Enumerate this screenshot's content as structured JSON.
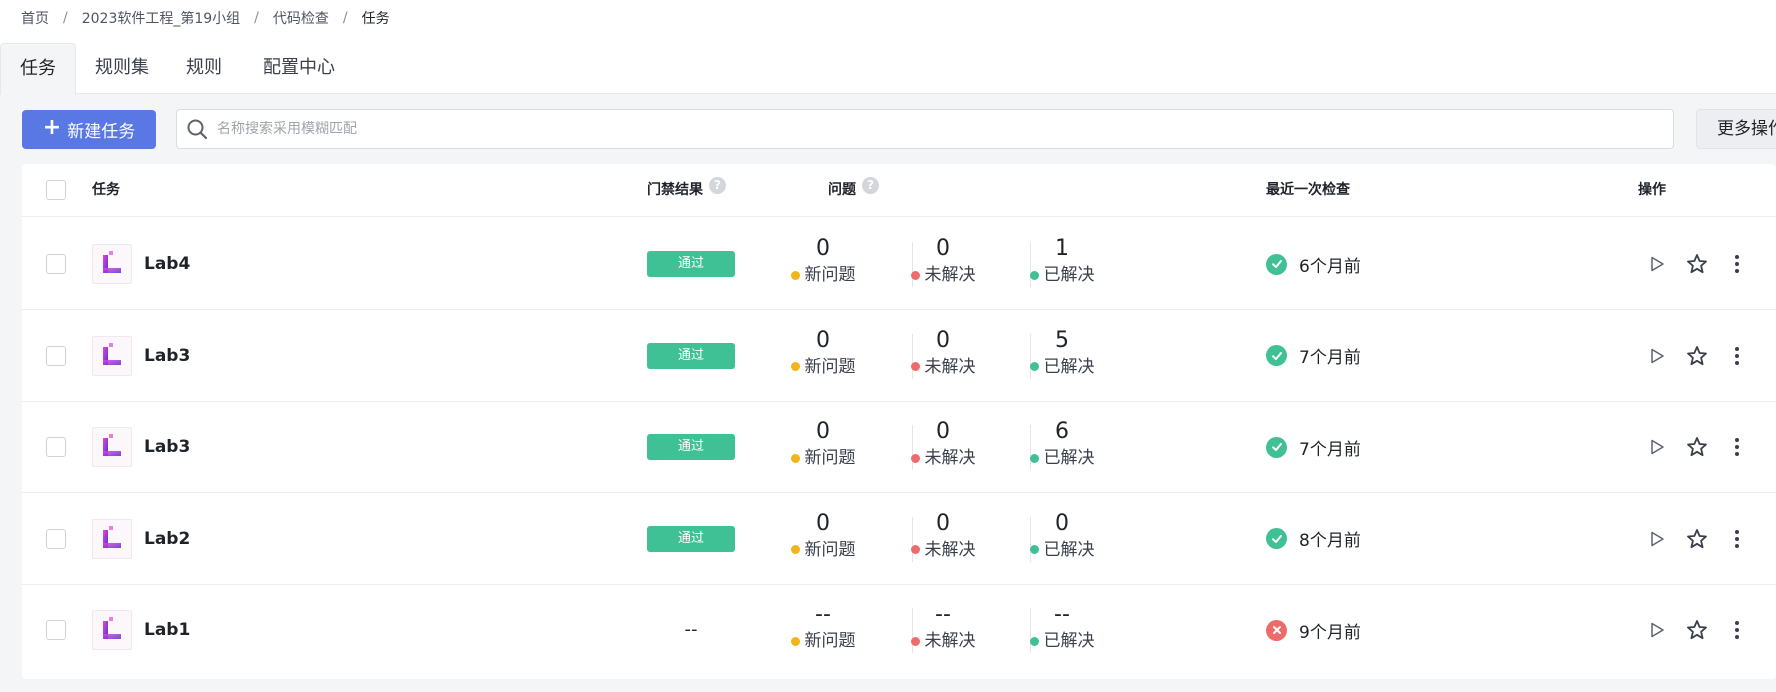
{
  "breadcrumb": [
    "首页",
    "2023软件工程_第19小组",
    "代码检查",
    "任务"
  ],
  "tabs": [
    {
      "label": "任务",
      "active": true
    },
    {
      "label": "规则集",
      "active": false
    },
    {
      "label": "规则",
      "active": false
    },
    {
      "label": "配置中心",
      "active": false
    }
  ],
  "toolbar": {
    "new_task_label": "新建任务",
    "search_placeholder": "名称搜索采用模糊匹配",
    "more_label": "更多操作"
  },
  "table": {
    "headers": {
      "task": "任务",
      "gate": "门禁结果",
      "issues": "问题",
      "last_check": "最近一次检查",
      "ops": "操作"
    },
    "issue_labels": {
      "new": "新问题",
      "unresolved": "未解决",
      "resolved": "已解决"
    },
    "rows": [
      {
        "name": "Lab4",
        "gate": "通过",
        "new": "0",
        "unresolved": "0",
        "resolved": "1",
        "status": "success",
        "last_check": "6个月前"
      },
      {
        "name": "Lab3",
        "gate": "通过",
        "new": "0",
        "unresolved": "0",
        "resolved": "5",
        "status": "success",
        "last_check": "7个月前"
      },
      {
        "name": "Lab3",
        "gate": "通过",
        "new": "0",
        "unresolved": "0",
        "resolved": "6",
        "status": "success",
        "last_check": "7个月前"
      },
      {
        "name": "Lab2",
        "gate": "通过",
        "new": "0",
        "unresolved": "0",
        "resolved": "0",
        "status": "success",
        "last_check": "8个月前"
      },
      {
        "name": "Lab1",
        "gate": "--",
        "new": "--",
        "unresolved": "--",
        "resolved": "--",
        "status": "failed",
        "last_check": "9个月前"
      }
    ]
  },
  "colors": {
    "primary": "#5978e3",
    "pass": "#3fc095",
    "fail": "#ef6b6b",
    "new_dot": "#f2b418",
    "unresolved_dot": "#ef6b6b",
    "resolved_dot": "#3fc095"
  }
}
